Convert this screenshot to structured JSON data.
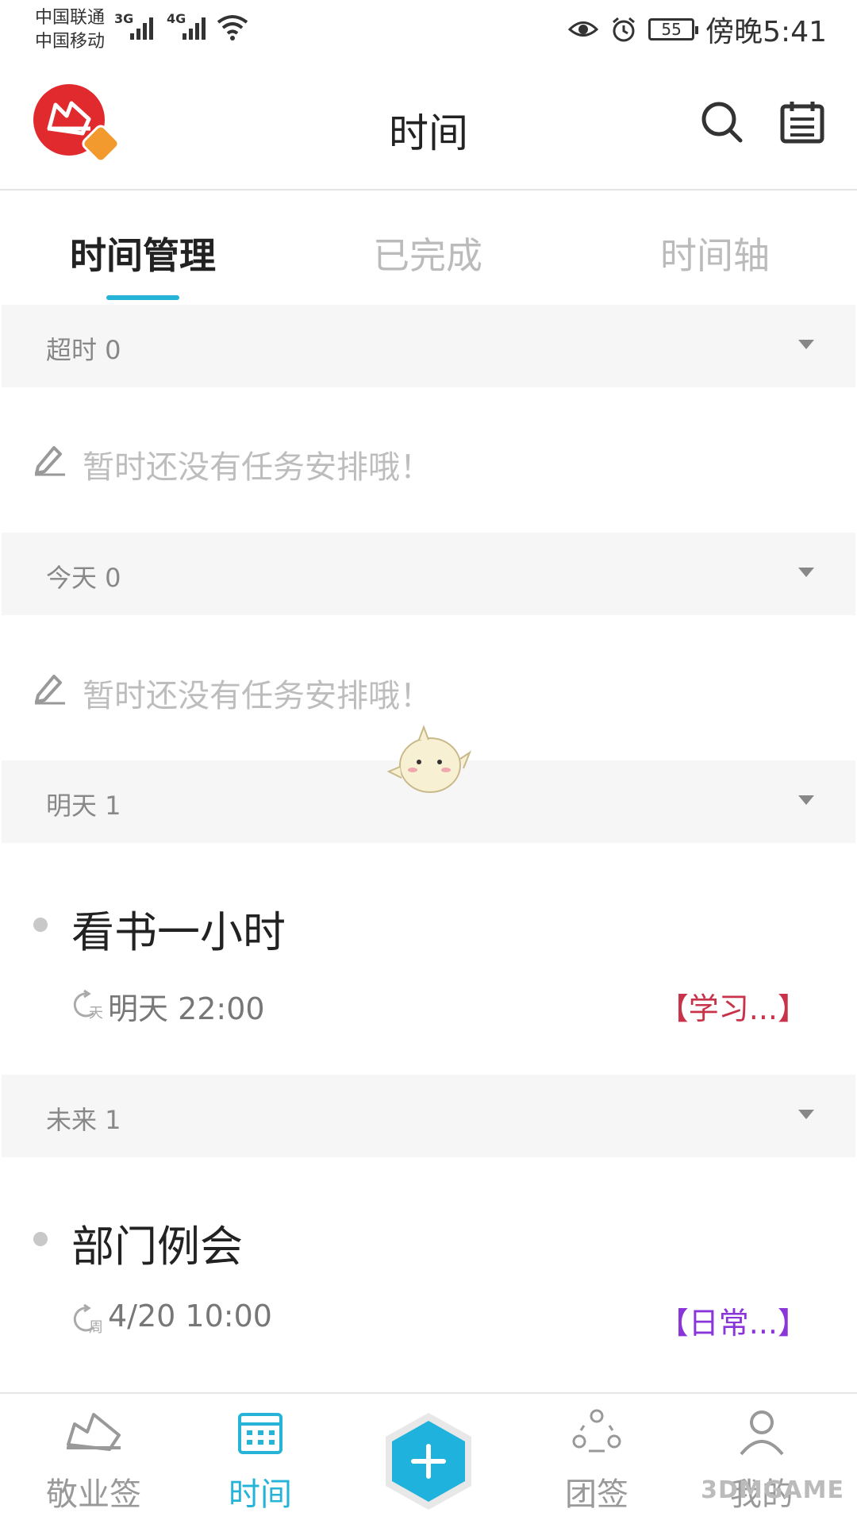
{
  "status_bar": {
    "carrier1": "中国联通",
    "carrier2": "中国移动",
    "net1": "3G",
    "net2": "4G",
    "battery": "55",
    "time": "傍晚5:41"
  },
  "header": {
    "title": "时间",
    "icons": [
      "app-logo",
      "search-icon",
      "calendar-icon"
    ]
  },
  "tabs": [
    {
      "label": "时间管理",
      "active": true
    },
    {
      "label": "已完成",
      "active": false
    },
    {
      "label": "时间轴",
      "active": false
    }
  ],
  "sections": {
    "overdue": {
      "label": "超时 0",
      "empty_text": "暂时还没有任务安排哦！"
    },
    "today": {
      "label": "今天 0",
      "empty_text": "暂时还没有任务安排哦！"
    },
    "tomorrow": {
      "label": "明天 1",
      "task": {
        "title": "看书一小时",
        "repeat_icon": "天",
        "time": "明天 22:00",
        "tag": "【学习...】",
        "tag_color": "#c8334a"
      }
    },
    "future": {
      "label": "未来 1",
      "task": {
        "title": "部门例会",
        "repeat_icon": "周",
        "time": "4/20 10:00",
        "tag": "【日常...】",
        "tag_color": "#8a35d9"
      }
    }
  },
  "bottom_nav": {
    "items": [
      {
        "label": "敬业签",
        "icon": "note-icon",
        "active": false
      },
      {
        "label": "时间",
        "icon": "calendar-icon",
        "active": true
      },
      {
        "label": "团签",
        "icon": "team-icon",
        "active": false
      },
      {
        "label": "我的",
        "icon": "user-icon",
        "active": false
      }
    ],
    "fab_icon": "plus-icon",
    "watermark": "3DMGAME"
  },
  "colors": {
    "accent": "#25b4d8",
    "brand": "#e02a2e",
    "badge": "#f29a2e"
  }
}
